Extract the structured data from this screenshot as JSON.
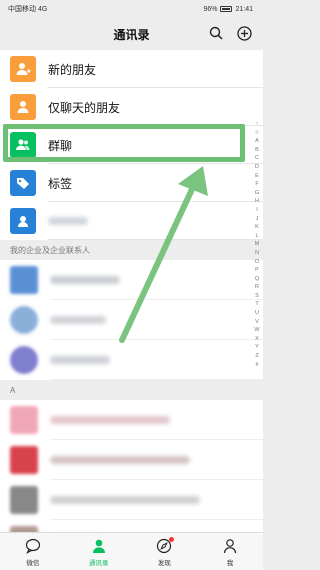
{
  "status_bar": {
    "carrier": "中国移动 4G",
    "battery": "96%",
    "time": "21:41"
  },
  "header": {
    "title": "通讯录",
    "search_icon": "search-icon",
    "add_icon": "plus-circle-icon"
  },
  "top_items": [
    {
      "label": "新的朋友",
      "color": "#fa9d3b",
      "icon": "add-friend-icon"
    },
    {
      "label": "仅聊天的朋友",
      "color": "#fa9d3b",
      "icon": "chat-only-friend-icon"
    },
    {
      "label": "群聊",
      "color": "#07c160",
      "icon": "group-chat-icon"
    },
    {
      "label": "标签",
      "color": "#2782d7",
      "icon": "tag-icon"
    },
    {
      "label": "",
      "color": "#2782d7",
      "icon": "official-account-icon"
    }
  ],
  "section_enterprise": "我的企业及企业联系人",
  "section_a": "A",
  "index_letters": [
    "↑",
    "☆",
    "A",
    "B",
    "C",
    "D",
    "E",
    "F",
    "G",
    "H",
    "I",
    "J",
    "K",
    "L",
    "M",
    "N",
    "O",
    "P",
    "Q",
    "R",
    "S",
    "T",
    "U",
    "V",
    "W",
    "X",
    "Y",
    "Z",
    "#"
  ],
  "tabs": [
    {
      "label": "微信",
      "icon": "chat-bubble-icon",
      "active": false
    },
    {
      "label": "通讯录",
      "icon": "contacts-icon",
      "active": true
    },
    {
      "label": "发现",
      "icon": "compass-icon",
      "active": false
    },
    {
      "label": "我",
      "icon": "person-icon",
      "active": false
    }
  ],
  "colors": {
    "accent": "#07c160",
    "highlight": "#6dbf73",
    "arrow": "#7ac47f"
  }
}
